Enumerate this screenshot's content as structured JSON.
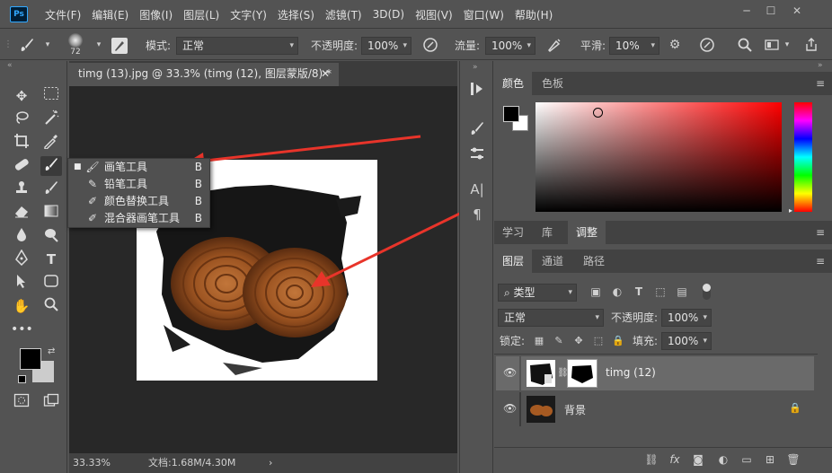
{
  "app": {
    "logo_text": "Ps"
  },
  "menu": [
    "文件(F)",
    "编辑(E)",
    "图像(I)",
    "图层(L)",
    "文字(Y)",
    "选择(S)",
    "滤镜(T)",
    "3D(D)",
    "视图(V)",
    "窗口(W)",
    "帮助(H)"
  ],
  "window_controls": {
    "minimize": "─",
    "maximize": "☐",
    "close": "✕"
  },
  "options_bar": {
    "brush_size": "72",
    "mode_label": "模式:",
    "mode_value": "正常",
    "opacity_label": "不透明度:",
    "opacity_value": "100%",
    "flow_label": "流量:",
    "flow_value": "100%",
    "smooth_label": "平滑:",
    "smooth_value": "10%"
  },
  "document": {
    "tab_title": "timg (13).jpg @ 33.3% (timg (12), 图层蒙版/8) *",
    "close": "✕",
    "zoom": "33.33%",
    "doc_info": "文档:1.68M/4.30M",
    "status_arrow": "›"
  },
  "flyout": [
    {
      "icon": "brush-icon",
      "label": "画笔工具",
      "key": "B",
      "active": true
    },
    {
      "icon": "pencil-icon",
      "label": "铅笔工具",
      "key": "B",
      "active": false
    },
    {
      "icon": "color-replace-icon",
      "label": "颜色替换工具",
      "key": "B",
      "active": false
    },
    {
      "icon": "mixer-brush-icon",
      "label": "混合器画笔工具",
      "key": "B",
      "active": false
    }
  ],
  "color_panel": {
    "tabs": [
      "颜色",
      "色板"
    ],
    "foreground": "#000000",
    "background": "#ffffff",
    "hue_color": "#ff0000"
  },
  "mid_panel": {
    "tabs": [
      "学习",
      "库",
      "调整"
    ]
  },
  "layers_panel": {
    "tabs": [
      "图层",
      "通道",
      "路径"
    ],
    "filter_label": "类型",
    "blend_mode": "正常",
    "opacity_label": "不透明度:",
    "opacity_value": "100%",
    "lock_label": "锁定:",
    "fill_label": "填充:",
    "fill_value": "100%",
    "layers": [
      {
        "name": "timg (12)",
        "selected": true,
        "has_mask": true,
        "locked": false
      },
      {
        "name": "背景",
        "selected": false,
        "has_mask": false,
        "locked": true
      }
    ]
  }
}
